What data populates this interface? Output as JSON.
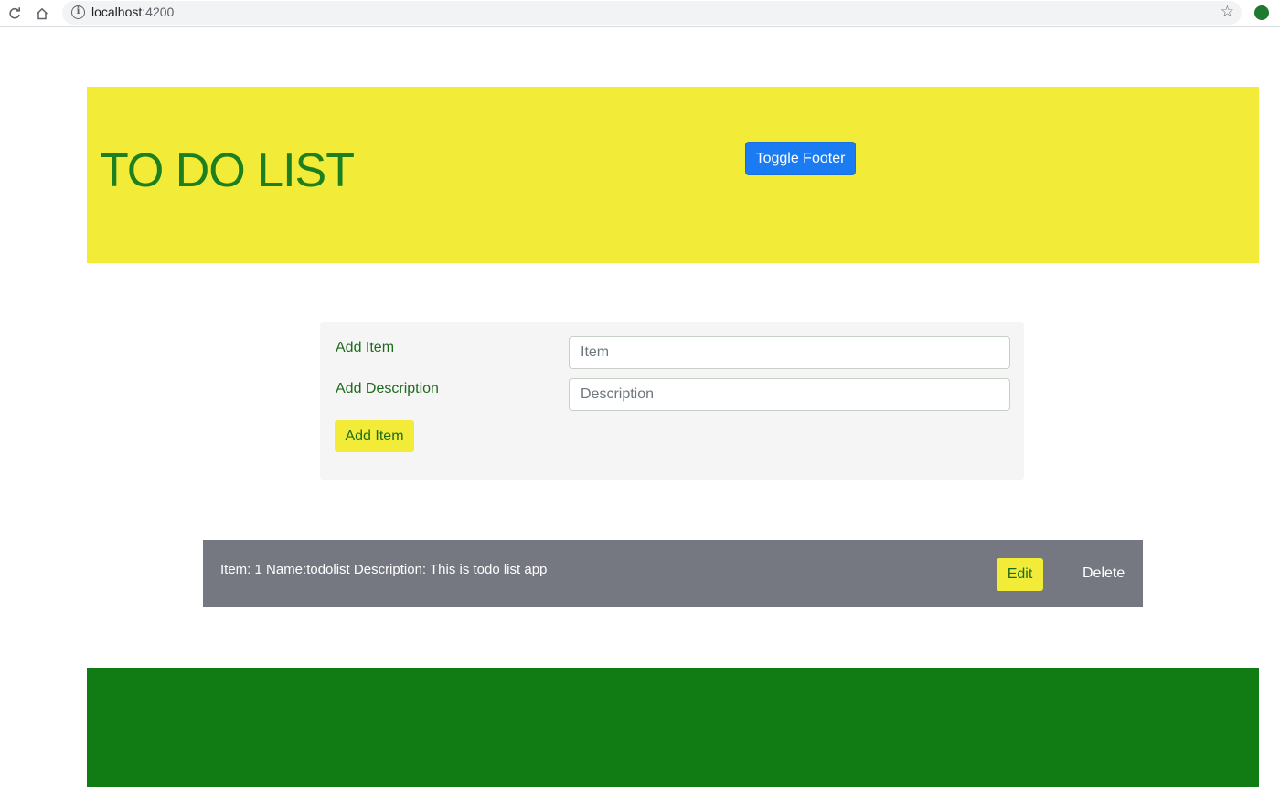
{
  "browser": {
    "url_host": "localhost",
    "url_port": ":4200"
  },
  "header": {
    "title": "TO DO LIST",
    "toggle_button_label": "Toggle Footer"
  },
  "form": {
    "item_label": "Add Item",
    "item_placeholder": "Item",
    "description_label": "Add Description",
    "description_placeholder": "Description",
    "submit_label": "Add Item"
  },
  "todo_items": [
    {
      "text": "Item: 1 Name:todolist Description: This is todo list app",
      "edit_label": "Edit",
      "delete_label": "Delete"
    }
  ],
  "colors": {
    "header_bg": "#f2ec38",
    "title_text": "#1d7f1d",
    "primary_button": "#1a7bf2",
    "row_bg": "#757880",
    "footer_bg": "#127c14"
  },
  "icons": {
    "reload": "reload-icon",
    "home": "home-icon",
    "info": "info-icon",
    "bookmark": "star-icon",
    "extension": "extension-icon"
  }
}
